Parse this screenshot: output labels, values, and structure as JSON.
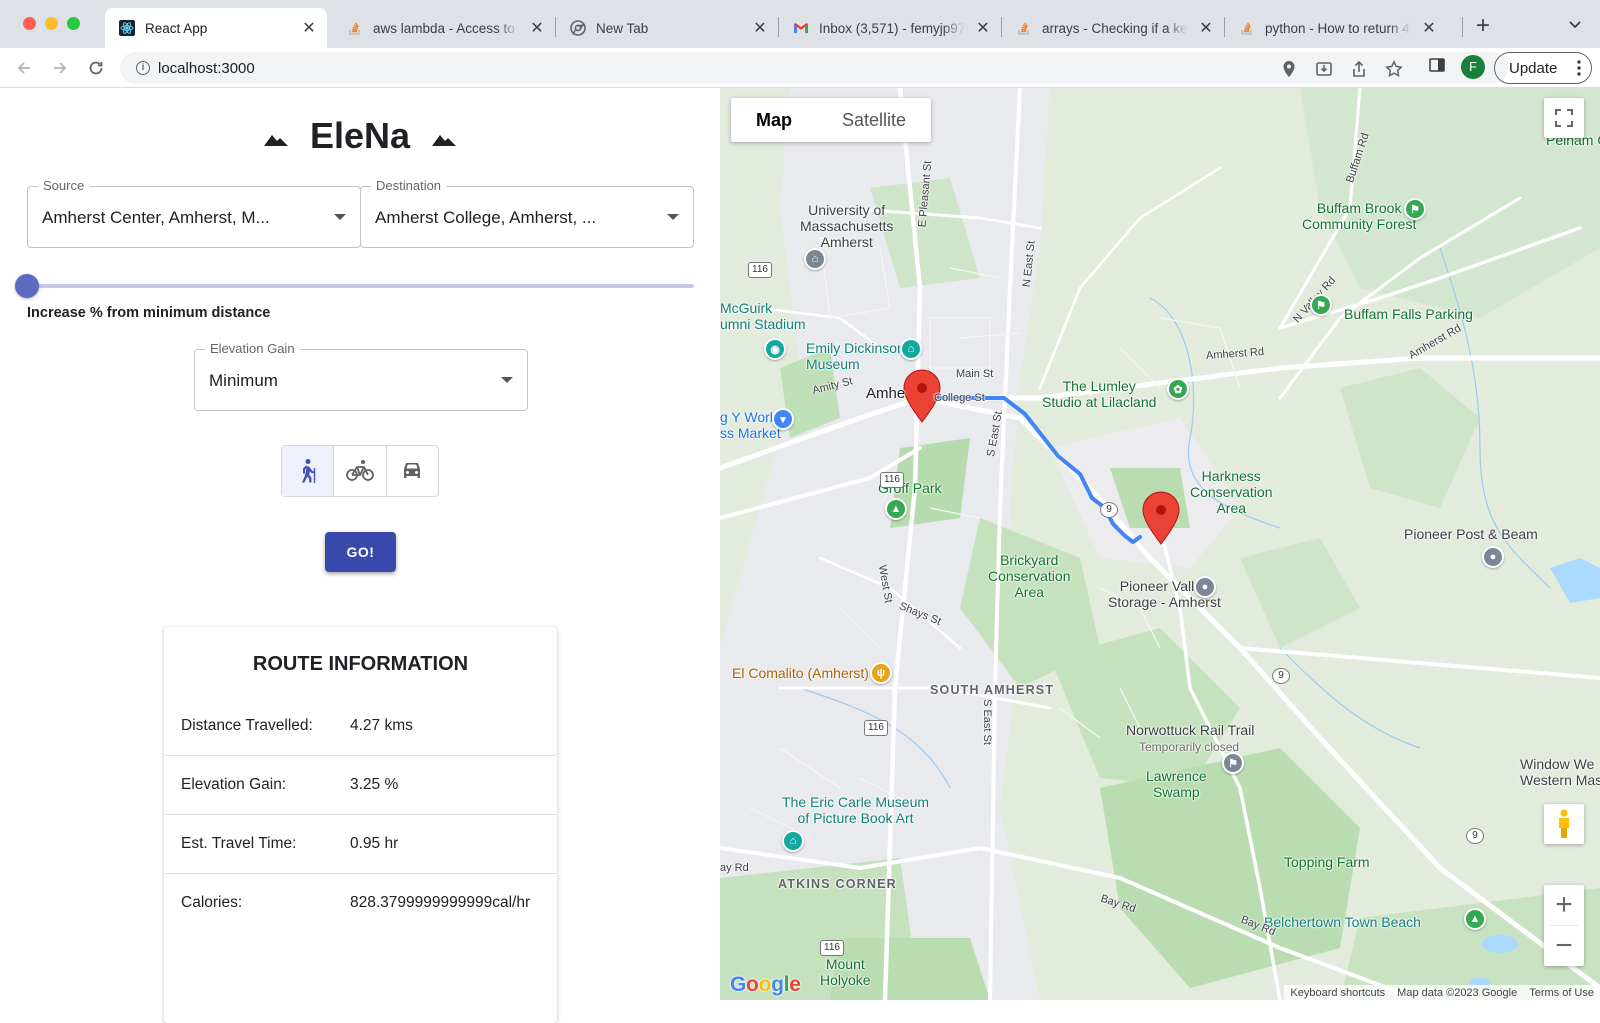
{
  "browser": {
    "tabs": [
      {
        "title": "React App",
        "active": true,
        "favicon": "react-icon"
      },
      {
        "title": "aws lambda - Access to",
        "active": false,
        "favicon": "stackoverflow-icon"
      },
      {
        "title": "New Tab",
        "active": false,
        "favicon": "chrome-icon"
      },
      {
        "title": "Inbox (3,571) - femyjp97",
        "active": false,
        "favicon": "gmail-icon"
      },
      {
        "title": "arrays - Checking if a key",
        "active": false,
        "favicon": "stackoverflow-icon"
      },
      {
        "title": "python - How to return 4",
        "active": false,
        "favicon": "stackoverflow-icon"
      }
    ],
    "url": "localhost:3000",
    "profile_initial": "F",
    "update_label": "Update"
  },
  "app": {
    "title": "EleNa",
    "source": {
      "label": "Source",
      "value": "Amherst Center, Amherst, M..."
    },
    "destination": {
      "label": "Destination",
      "value": "Amherst College, Amherst, ..."
    },
    "slider": {
      "label": "Increase % from minimum distance",
      "value_percent": 0
    },
    "elevation": {
      "label": "Elevation Gain",
      "value": "Minimum"
    },
    "modes": [
      {
        "name": "walking-icon",
        "selected": true
      },
      {
        "name": "bike-icon",
        "selected": false
      },
      {
        "name": "car-icon",
        "selected": false
      }
    ],
    "go_label": "GO!",
    "route_info": {
      "title": "ROUTE INFORMATION",
      "rows": [
        {
          "label": "Distance Travelled:",
          "value": "4.27 kms"
        },
        {
          "label": "Elevation Gain:",
          "value": "3.25 %"
        },
        {
          "label": "Est. Travel Time:",
          "value": "0.95 hr"
        },
        {
          "label": "Calories:",
          "value": "828.3799999999999cal/hr"
        }
      ]
    }
  },
  "map": {
    "type_buttons": [
      "Map",
      "Satellite"
    ],
    "active_type": "Map",
    "labels": {
      "umass": "University of\nMassachusetts\nAmherst",
      "mcguirk": "McGuirk\numni Stadium",
      "dickinson": "Emily Dickinson\nMuseum",
      "amherst": "Amhe",
      "college_st": "College St",
      "main_st": "Main St",
      "amity_st": "Amity St",
      "world_market": "g Y World\nss Market",
      "groff": "Groff Park",
      "brickyard": "Brickyard\nConservation\nArea",
      "lumley": "The Lumley\nStudio at Lilacland",
      "harkness": "Harkness\nConservation\nArea",
      "buffam_forest": "Buffam Brook\nCommunity Forest",
      "buffam_falls": "Buffam Falls Parking",
      "pioneer_post": "Pioneer Post & Beam",
      "pioneer_storage": "Pioneer Valley\nStorage - Amherst",
      "el_comalito": "El Comalito (Amherst)",
      "south_amherst": "SOUTH AMHERST",
      "norwottuck": "Norwottuck Rail Trail",
      "temporarily_closed": "Temporarily closed",
      "lawrence": "Lawrence\nSwamp",
      "carle": "The Eric Carle Museum\nof Picture Book Art",
      "atkins": "ATKINS CORNER",
      "topping": "Topping Farm",
      "belchertown": "Belchertown Town Beach",
      "mount_holyoke": "Mount\nHolyoke",
      "pelham": "Pelham Ove",
      "window_west": "Window We\nWestern Massach",
      "amherst_rd": "Amherst Rd",
      "n_valley_rd": "N Valley Rd",
      "amherst_rd_2": "Amherst Rd",
      "bay_rd": "Bay Rd",
      "bay_rd_2": "Bay Rd",
      "ay_rd": "ay Rd",
      "shays_st": "Shays St",
      "west_st": "West St",
      "s_east_st": "S East St",
      "s_east_st_2": "S East St",
      "n_east_st": "N East St",
      "e_pleasant_st": "E Pleasant St",
      "buffam_rd": "Buffam Rd"
    },
    "shields": [
      "116",
      "116",
      "116",
      "116",
      "9",
      "9",
      "9"
    ],
    "google_logo": "Google",
    "attribution": [
      "Keyboard shortcuts",
      "Map data ©2023 Google",
      "Terms of Use"
    ]
  }
}
